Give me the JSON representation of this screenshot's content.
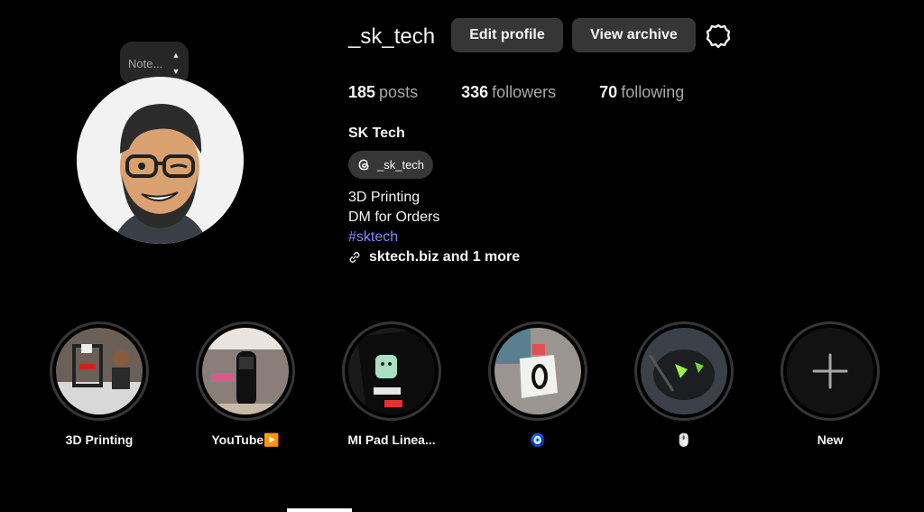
{
  "note": {
    "placeholder": "Note..."
  },
  "profile": {
    "username": "_sk_tech",
    "edit_label": "Edit profile",
    "archive_label": "View archive",
    "stats": {
      "posts_count": "185",
      "posts_label": "posts",
      "followers_count": "336",
      "followers_label": "followers",
      "following_count": "70",
      "following_label": "following"
    },
    "full_name": "SK Tech",
    "threads_handle": "_sk_tech",
    "bio_line1": "3D Printing",
    "bio_line2": "DM for Orders",
    "hashtag": "#sktech",
    "link_text": "sktech.biz and 1 more"
  },
  "highlights": [
    {
      "label": "3D Printing",
      "icon": "printer-photo"
    },
    {
      "label": "YouTube▶️",
      "icon": "band-photo"
    },
    {
      "label": "MI Pad Linea...",
      "icon": "fastboot-photo"
    },
    {
      "label": "🧿",
      "icon": "gauge-photo"
    },
    {
      "label": "🖱️",
      "icon": "mouse-photo"
    },
    {
      "label": "New",
      "icon": "plus-icon"
    }
  ],
  "colors": {
    "background": "#000000",
    "button": "#363636",
    "hashtag": "#7f8cff",
    "muted": "#a8a8a8"
  }
}
